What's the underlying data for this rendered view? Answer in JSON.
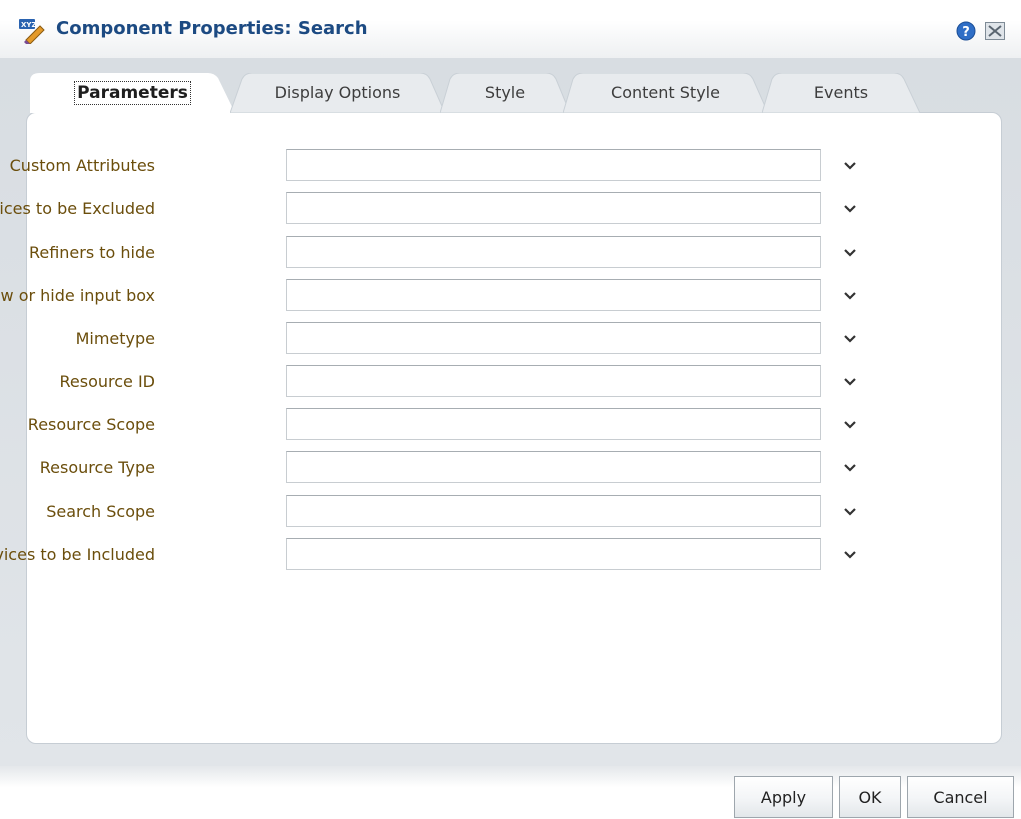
{
  "window": {
    "title": "Component Properties: Search",
    "icons": {
      "app": "component-properties-icon",
      "help": "help-icon",
      "close": "close-icon"
    }
  },
  "tabs": [
    {
      "label": "Parameters",
      "active": true
    },
    {
      "label": "Display Options",
      "active": false
    },
    {
      "label": "Style",
      "active": false
    },
    {
      "label": "Content Style",
      "active": false
    },
    {
      "label": "Events",
      "active": false
    }
  ],
  "parameters": [
    {
      "label": "Custom Attributes",
      "value": ""
    },
    {
      "label": "Services to be Excluded",
      "value": ""
    },
    {
      "label": "Refiners to hide",
      "value": ""
    },
    {
      "label": "Show or hide input box",
      "value": ""
    },
    {
      "label": "Mimetype",
      "value": ""
    },
    {
      "label": "Resource ID",
      "value": ""
    },
    {
      "label": "Resource Scope",
      "value": ""
    },
    {
      "label": "Resource Type",
      "value": ""
    },
    {
      "label": "Search Scope",
      "value": ""
    },
    {
      "label": "Services to be Included",
      "value": ""
    }
  ],
  "buttons": {
    "apply": "Apply",
    "ok": "OK",
    "cancel": "Cancel"
  },
  "colors": {
    "title": "#1c4a82",
    "label": "#6b4e0c"
  }
}
